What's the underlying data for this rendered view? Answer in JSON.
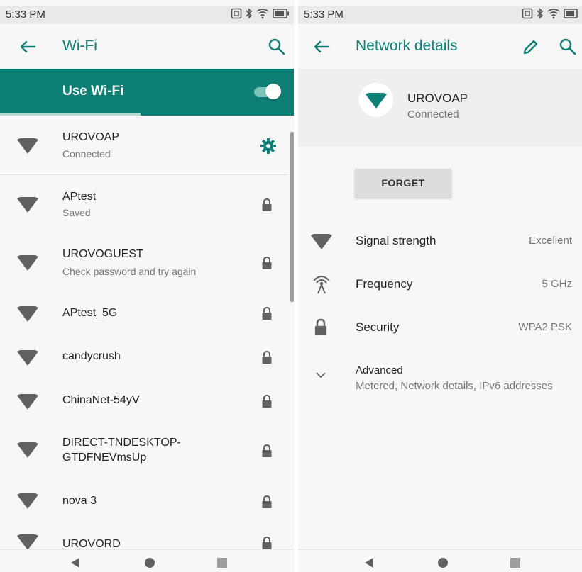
{
  "status_bar": {
    "time": "5:33 PM"
  },
  "left_screen": {
    "title": "Wi-Fi",
    "use_wifi_label": "Use Wi-Fi",
    "use_wifi_on": true,
    "accent_color": "#0e7f74",
    "networks": [
      {
        "name": "UROVOAP",
        "status": "Connected",
        "trailing_icon": "gear-icon"
      },
      {
        "name": "APtest",
        "status": "Saved",
        "trailing_icon": "lock-icon"
      },
      {
        "name": "UROVOGUEST",
        "status": "Check password and try again",
        "trailing_icon": "lock-icon"
      },
      {
        "name": "APtest_5G",
        "status": "",
        "trailing_icon": "lock-icon"
      },
      {
        "name": "candycrush",
        "status": "",
        "trailing_icon": "lock-icon"
      },
      {
        "name": "ChinaNet-54yV",
        "status": "",
        "trailing_icon": "lock-icon"
      },
      {
        "name": "DIRECT-TNDESKTOP-",
        "name_line2": "GTDFNEVmsUp",
        "status": "",
        "trailing_icon": "lock-icon"
      },
      {
        "name": "nova 3",
        "status": "",
        "trailing_icon": "lock-icon"
      },
      {
        "name": "UROVORD",
        "status": "",
        "trailing_icon": "lock-icon"
      }
    ]
  },
  "right_screen": {
    "title": "Network details",
    "network_name": "UROVOAP",
    "network_status": "Connected",
    "forget_label": "FORGET",
    "details": [
      {
        "label": "Signal strength",
        "value": "Excellent",
        "icon": "wifi-signal-icon"
      },
      {
        "label": "Frequency",
        "value": "5 GHz",
        "icon": "antenna-icon"
      },
      {
        "label": "Security",
        "value": "WPA2 PSK",
        "icon": "lock-icon"
      }
    ],
    "advanced": {
      "label": "Advanced",
      "summary": "Metered, Network details, IPv6 addresses"
    }
  }
}
